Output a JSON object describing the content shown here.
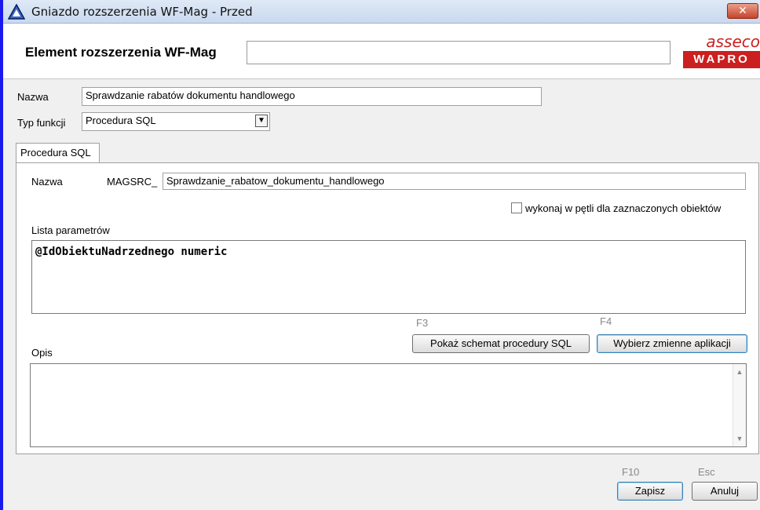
{
  "window": {
    "title": "Gniazdo rozszerzenia WF-Mag - Przed",
    "close_glyph": "✕"
  },
  "header": {
    "label": "Element rozszerzenia WF-Mag",
    "value": "",
    "logo_top": "asseco",
    "logo_bottom": "WAPRO"
  },
  "form": {
    "name_label": "Nazwa",
    "name_value": "Sprawdzanie rabatów dokumentu handlowego",
    "type_label": "Typ funkcji",
    "type_value": "Procedura SQL"
  },
  "tab": {
    "label": "Procedura SQL",
    "name_label": "Nazwa",
    "name_prefix": "MAGSRC_",
    "name_value": "Sprawdzanie_rabatow_dokumentu_handlowego",
    "loop_checkbox_label": "wykonaj w pętli dla zaznaczonych obiektów",
    "loop_checked": false,
    "params_label": "Lista parametrów",
    "params_value": "@IdObiektuNadrzednego numeric",
    "f3_hotkey": "F3",
    "f4_hotkey": "F4",
    "show_schema_button": "Pokaż schemat procedury SQL",
    "select_vars_button": "Wybierz zmienne aplikacji",
    "desc_label": "Opis",
    "desc_value": ""
  },
  "footer": {
    "save_hotkey": "F10",
    "cancel_hotkey": "Esc",
    "save_button": "Zapisz",
    "cancel_button": "Anuluj"
  },
  "colors": {
    "accent_border": "#1a1aee",
    "logo_red": "#cc1f1f"
  }
}
